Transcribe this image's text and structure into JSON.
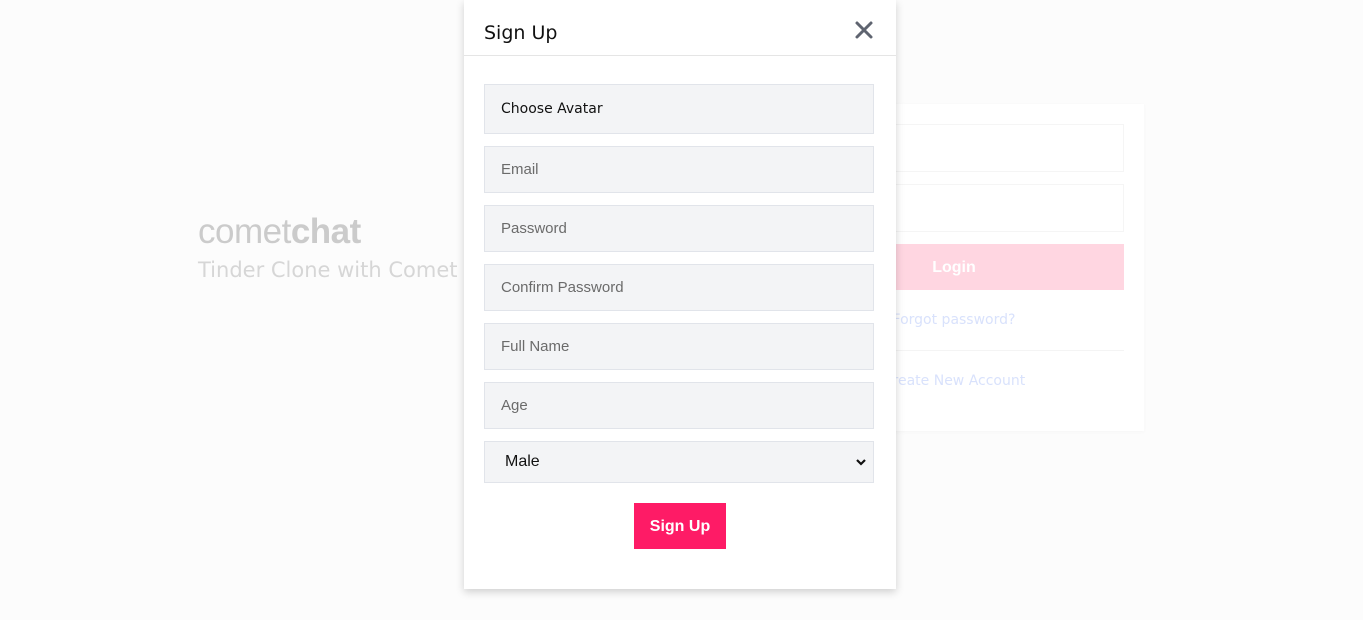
{
  "background": {
    "logo": {
      "light": "comet",
      "bold": "chat"
    },
    "tagline": "Tinder Clone with Comet",
    "login": {
      "button": "Login",
      "forgot_link": "Forgot password?",
      "create_link": "Create New Account"
    }
  },
  "modal": {
    "title": "Sign Up",
    "close_icon": "close-icon",
    "fields": {
      "avatar": "Choose Avatar",
      "email_placeholder": "Email",
      "password_placeholder": "Password",
      "confirm_placeholder": "Confirm Password",
      "fullname_placeholder": "Full Name",
      "age_placeholder": "Age",
      "gender_selected": "Male"
    },
    "submit": "Sign Up"
  },
  "colors": {
    "accent": "#fe1b66",
    "field_bg": "#f3f4f6"
  }
}
